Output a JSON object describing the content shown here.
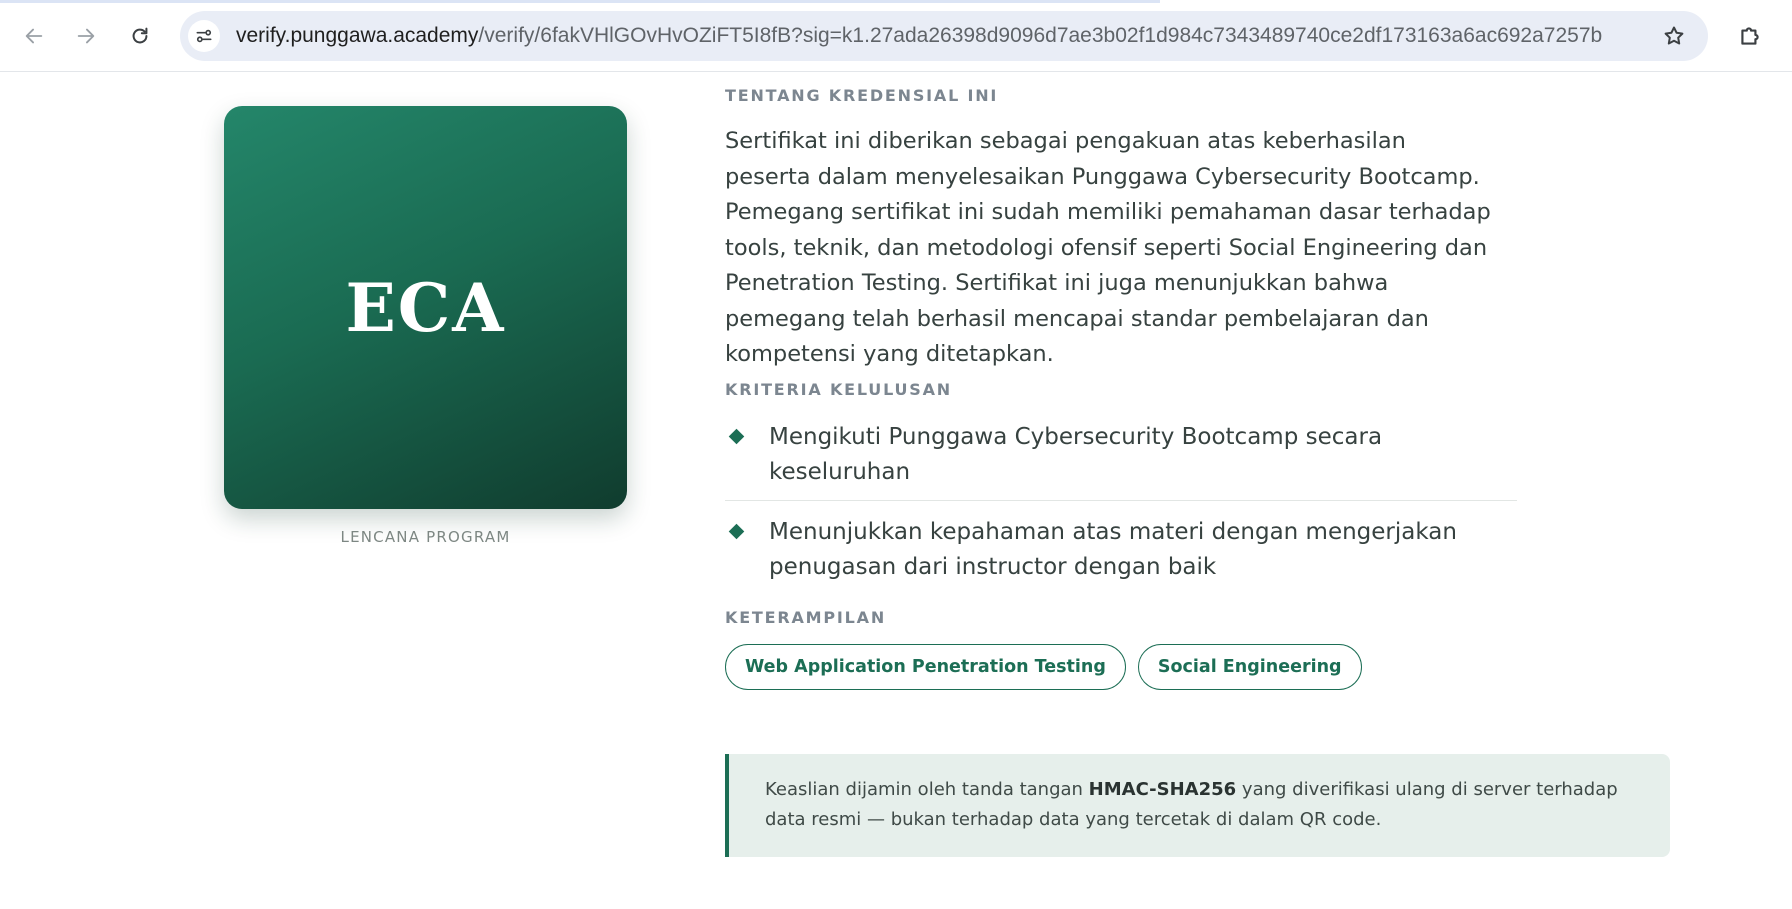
{
  "browser": {
    "url_host": "verify.punggawa.academy",
    "url_path": "/verify/6fakVHlGOvHvOZiFT5I8fB?sig=k1.27ada26398d9096d7ae3b02f1d984c7343489740ce2df173163a6ac692a7257b",
    "icons": {
      "back": "arrow-left-icon",
      "forward": "arrow-right-icon",
      "reload": "reload-icon",
      "site_info": "tune-icon",
      "bookmark": "star-icon",
      "extensions": "puzzle-icon"
    }
  },
  "badge": {
    "text": "ECA",
    "caption": "LENCANA PROGRAM",
    "gradient_colors": [
      "#24866a",
      "#1a6b52",
      "#103c2e"
    ]
  },
  "about": {
    "heading": "TENTANG KREDENSIAL INI",
    "body": "Sertifikat ini diberikan sebagai pengakuan atas keberhasilan peserta dalam menyelesaikan Punggawa Cybersecurity Bootcamp. Pemegang sertifikat ini sudah memiliki pemahaman dasar terhadap tools, teknik, dan metodologi ofensif seperti Social Engineering dan Penetration Testing. Sertifikat ini juga menunjukkan bahwa pemegang telah berhasil mencapai standar pembelajaran dan kompetensi yang ditetapkan."
  },
  "criteria": {
    "heading": "KRITERIA KELULUSAN",
    "items": [
      "Mengikuti Punggawa Cybersecurity Bootcamp secara keseluruhan",
      "Menunjukkan kepahaman atas materi dengan mengerjakan penugasan dari instructor dengan baik"
    ]
  },
  "skills": {
    "heading": "KETERAMPILAN",
    "items": [
      "Web Application Penetration Testing",
      "Social Engineering"
    ]
  },
  "notice": {
    "prefix": "Keaslian dijamin oleh tanda tangan ",
    "emphasis": "HMAC-SHA256",
    "suffix": " yang diverifikasi ulang di server terhadap data resmi — bukan terhadap data yang tercetak di dalam QR code."
  },
  "colors": {
    "accent": "#1c6e55",
    "notice_bg": "#e6efeb",
    "heading_gray": "#7c8690"
  }
}
